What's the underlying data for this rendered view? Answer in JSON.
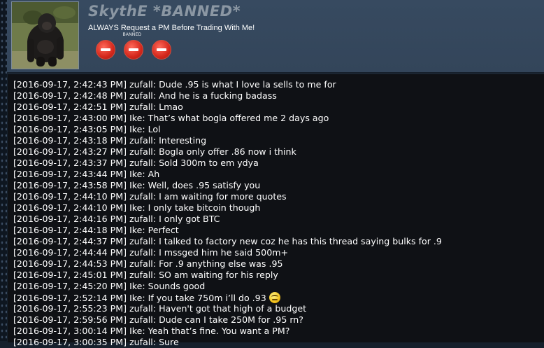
{
  "profile": {
    "username": "SkythE *BANNED*",
    "user_title": "ALWAYS Request a PM Before Trading With Me!",
    "badge_label": "BANNED",
    "badge_icons": [
      "banned-icon",
      "banned-icon",
      "banned-icon"
    ]
  },
  "chat": [
    {
      "timestamp": "[2016-09-17, 2:42:43 PM]",
      "user": "zufall",
      "message": "Dude .95 is what I love la sells to me for"
    },
    {
      "timestamp": "[2016-09-17, 2:42:48 PM]",
      "user": "zufall",
      "message": "And he is a fucking badass"
    },
    {
      "timestamp": "[2016-09-17, 2:42:51 PM]",
      "user": "zufall",
      "message": "Lmao"
    },
    {
      "timestamp": "[2016-09-17, 2:43:00 PM]",
      "user": "Ike",
      "message": "That’s what bogla offered me 2 days ago"
    },
    {
      "timestamp": "[2016-09-17, 2:43:05 PM]",
      "user": "Ike",
      "message": "Lol"
    },
    {
      "timestamp": "[2016-09-17, 2:43:18 PM]",
      "user": "zufall",
      "message": "Interesting"
    },
    {
      "timestamp": "[2016-09-17, 2:43:27 PM]",
      "user": "zufall",
      "message": "Bogla only offer .86 now i think"
    },
    {
      "timestamp": "[2016-09-17, 2:43:37 PM]",
      "user": "zufall",
      "message": "Sold 300m to em ydya"
    },
    {
      "timestamp": "[2016-09-17, 2:43:44 PM]",
      "user": "Ike",
      "message": "Ah"
    },
    {
      "timestamp": "[2016-09-17, 2:43:58 PM]",
      "user": "Ike",
      "message": "Well, does .95 satisfy you"
    },
    {
      "timestamp": "[2016-09-17, 2:44:10 PM]",
      "user": "zufall",
      "message": "I am waiting for more quotes"
    },
    {
      "timestamp": "[2016-09-17, 2:44:10 PM]",
      "user": "Ike",
      "message": "I only take bitcoin though"
    },
    {
      "timestamp": "[2016-09-17, 2:44:16 PM]",
      "user": "zufall",
      "message": "I only got BTC"
    },
    {
      "timestamp": "[2016-09-17, 2:44:18 PM]",
      "user": "Ike",
      "message": "Perfect"
    },
    {
      "timestamp": "[2016-09-17, 2:44:37 PM]",
      "user": "zufall",
      "message": "I talked to factory new coz he has this thread saying bulks for .9"
    },
    {
      "timestamp": "[2016-09-17, 2:44:44 PM]",
      "user": "zufall",
      "message": "I mssged him he said 500m+"
    },
    {
      "timestamp": "[2016-09-17, 2:44:53 PM]",
      "user": "zufall",
      "message": "For .9 anything else was .95"
    },
    {
      "timestamp": "[2016-09-17, 2:45:01 PM]",
      "user": "zufall",
      "message": "SO am waiting for his reply"
    },
    {
      "timestamp": "[2016-09-17, 2:45:20 PM]",
      "user": "Ike",
      "message": "Sounds good"
    },
    {
      "timestamp": "[2016-09-17, 2:52:14 PM]",
      "user": "Ike",
      "message": "If you take 750m i’ll do .93",
      "emoji": "smiley-icon"
    },
    {
      "timestamp": "[2016-09-17, 2:55:23 PM]",
      "user": "zufall",
      "message": "Haven't got that high of a budget"
    },
    {
      "timestamp": "[2016-09-17, 2:59:56 PM]",
      "user": "zufall",
      "message": "Dude can I take 250M for .95 rn?"
    },
    {
      "timestamp": "[2016-09-17, 3:00:14 PM]",
      "user": "Ike",
      "message": "Yeah that’s fine. You want a PM?"
    },
    {
      "timestamp": "[2016-09-17, 3:00:35 PM]",
      "user": "zufall",
      "message": "Sure"
    }
  ]
}
